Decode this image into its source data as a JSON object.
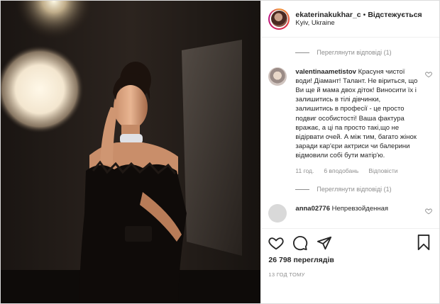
{
  "post": {
    "username": "ekaterinakukhar_c",
    "separator": "•",
    "follow_label": "Відстежується",
    "location": "Kyiv, Ukraine"
  },
  "comments": {
    "view_replies_1": "Переглянути відповіді (1)",
    "comment_1": {
      "username": "valentinaametistov",
      "text": "Красуня чистої води! Діамант! Талант. Не віриться, що Ви ще й мама двох діток! Виносити їх і залишитись в тілі дівчинки, залишитись в професії - це просто подвиг особистості! Ваша фактура вражає, а ці па просто такі,що не відірвати очей. А між тим, багато жінок заради кар'єри актриси чи балерини відмовили собі бути матір'ю.",
      "time": "11 год.",
      "likes": "6 вподобань",
      "reply_label": "Відповісти"
    },
    "view_replies_2": "Переглянути відповіді (1)",
    "comment_2": {
      "username": "anna02776",
      "text": "Непревзойденная"
    }
  },
  "actions": {
    "like_icon": "heart-icon",
    "comment_icon": "comment-icon",
    "share_icon": "share-icon",
    "save_icon": "bookmark-icon"
  },
  "views": "26 798 переглядів",
  "posted": "13 ГОД ТОМУ",
  "colors": {
    "border": "#dbdbdb",
    "secondary_text": "#8e8e8e",
    "primary_text": "#262626"
  }
}
